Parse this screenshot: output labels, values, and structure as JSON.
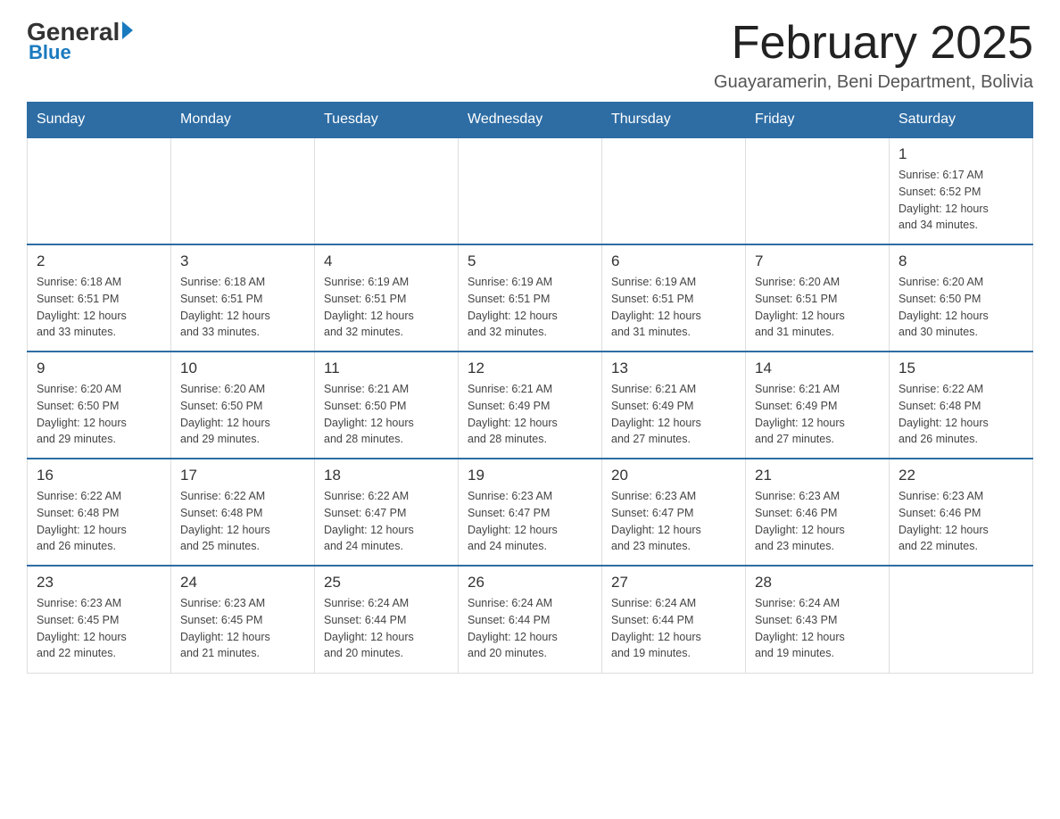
{
  "header": {
    "logo_general": "General",
    "logo_blue": "Blue",
    "month_title": "February 2025",
    "location": "Guayaramerin, Beni Department, Bolivia"
  },
  "weekdays": [
    "Sunday",
    "Monday",
    "Tuesday",
    "Wednesday",
    "Thursday",
    "Friday",
    "Saturday"
  ],
  "weeks": [
    [
      {
        "day": "",
        "info": ""
      },
      {
        "day": "",
        "info": ""
      },
      {
        "day": "",
        "info": ""
      },
      {
        "day": "",
        "info": ""
      },
      {
        "day": "",
        "info": ""
      },
      {
        "day": "",
        "info": ""
      },
      {
        "day": "1",
        "info": "Sunrise: 6:17 AM\nSunset: 6:52 PM\nDaylight: 12 hours\nand 34 minutes."
      }
    ],
    [
      {
        "day": "2",
        "info": "Sunrise: 6:18 AM\nSunset: 6:51 PM\nDaylight: 12 hours\nand 33 minutes."
      },
      {
        "day": "3",
        "info": "Sunrise: 6:18 AM\nSunset: 6:51 PM\nDaylight: 12 hours\nand 33 minutes."
      },
      {
        "day": "4",
        "info": "Sunrise: 6:19 AM\nSunset: 6:51 PM\nDaylight: 12 hours\nand 32 minutes."
      },
      {
        "day": "5",
        "info": "Sunrise: 6:19 AM\nSunset: 6:51 PM\nDaylight: 12 hours\nand 32 minutes."
      },
      {
        "day": "6",
        "info": "Sunrise: 6:19 AM\nSunset: 6:51 PM\nDaylight: 12 hours\nand 31 minutes."
      },
      {
        "day": "7",
        "info": "Sunrise: 6:20 AM\nSunset: 6:51 PM\nDaylight: 12 hours\nand 31 minutes."
      },
      {
        "day": "8",
        "info": "Sunrise: 6:20 AM\nSunset: 6:50 PM\nDaylight: 12 hours\nand 30 minutes."
      }
    ],
    [
      {
        "day": "9",
        "info": "Sunrise: 6:20 AM\nSunset: 6:50 PM\nDaylight: 12 hours\nand 29 minutes."
      },
      {
        "day": "10",
        "info": "Sunrise: 6:20 AM\nSunset: 6:50 PM\nDaylight: 12 hours\nand 29 minutes."
      },
      {
        "day": "11",
        "info": "Sunrise: 6:21 AM\nSunset: 6:50 PM\nDaylight: 12 hours\nand 28 minutes."
      },
      {
        "day": "12",
        "info": "Sunrise: 6:21 AM\nSunset: 6:49 PM\nDaylight: 12 hours\nand 28 minutes."
      },
      {
        "day": "13",
        "info": "Sunrise: 6:21 AM\nSunset: 6:49 PM\nDaylight: 12 hours\nand 27 minutes."
      },
      {
        "day": "14",
        "info": "Sunrise: 6:21 AM\nSunset: 6:49 PM\nDaylight: 12 hours\nand 27 minutes."
      },
      {
        "day": "15",
        "info": "Sunrise: 6:22 AM\nSunset: 6:48 PM\nDaylight: 12 hours\nand 26 minutes."
      }
    ],
    [
      {
        "day": "16",
        "info": "Sunrise: 6:22 AM\nSunset: 6:48 PM\nDaylight: 12 hours\nand 26 minutes."
      },
      {
        "day": "17",
        "info": "Sunrise: 6:22 AM\nSunset: 6:48 PM\nDaylight: 12 hours\nand 25 minutes."
      },
      {
        "day": "18",
        "info": "Sunrise: 6:22 AM\nSunset: 6:47 PM\nDaylight: 12 hours\nand 24 minutes."
      },
      {
        "day": "19",
        "info": "Sunrise: 6:23 AM\nSunset: 6:47 PM\nDaylight: 12 hours\nand 24 minutes."
      },
      {
        "day": "20",
        "info": "Sunrise: 6:23 AM\nSunset: 6:47 PM\nDaylight: 12 hours\nand 23 minutes."
      },
      {
        "day": "21",
        "info": "Sunrise: 6:23 AM\nSunset: 6:46 PM\nDaylight: 12 hours\nand 23 minutes."
      },
      {
        "day": "22",
        "info": "Sunrise: 6:23 AM\nSunset: 6:46 PM\nDaylight: 12 hours\nand 22 minutes."
      }
    ],
    [
      {
        "day": "23",
        "info": "Sunrise: 6:23 AM\nSunset: 6:45 PM\nDaylight: 12 hours\nand 22 minutes."
      },
      {
        "day": "24",
        "info": "Sunrise: 6:23 AM\nSunset: 6:45 PM\nDaylight: 12 hours\nand 21 minutes."
      },
      {
        "day": "25",
        "info": "Sunrise: 6:24 AM\nSunset: 6:44 PM\nDaylight: 12 hours\nand 20 minutes."
      },
      {
        "day": "26",
        "info": "Sunrise: 6:24 AM\nSunset: 6:44 PM\nDaylight: 12 hours\nand 20 minutes."
      },
      {
        "day": "27",
        "info": "Sunrise: 6:24 AM\nSunset: 6:44 PM\nDaylight: 12 hours\nand 19 minutes."
      },
      {
        "day": "28",
        "info": "Sunrise: 6:24 AM\nSunset: 6:43 PM\nDaylight: 12 hours\nand 19 minutes."
      },
      {
        "day": "",
        "info": ""
      }
    ]
  ]
}
